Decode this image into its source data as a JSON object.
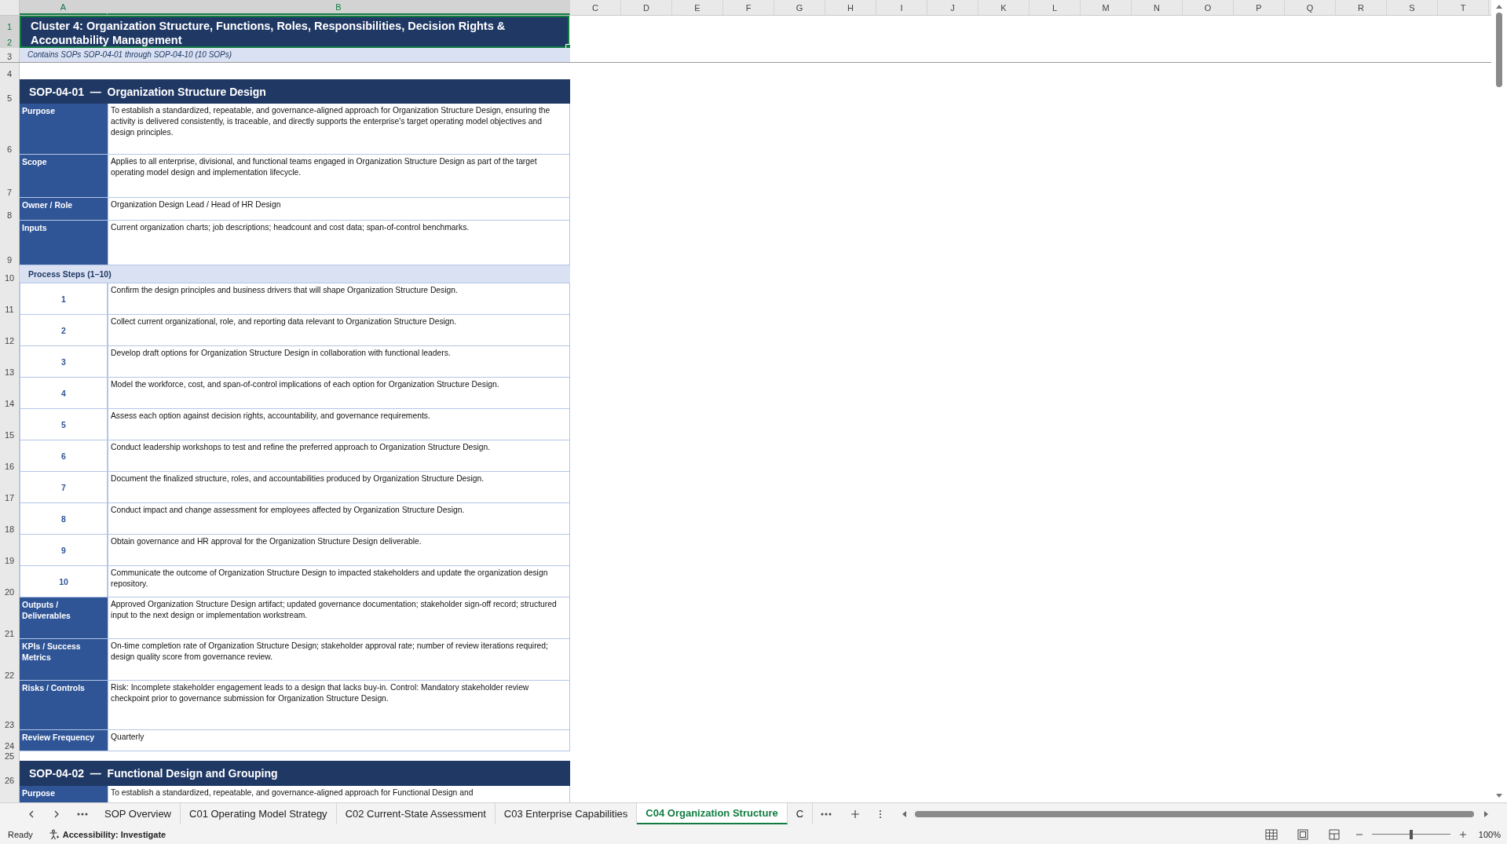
{
  "column_headers": [
    {
      "label": "A",
      "selected": true
    },
    {
      "label": "B",
      "selected": true
    },
    {
      "label": "C",
      "selected": false
    },
    {
      "label": "D",
      "selected": false
    },
    {
      "label": "E",
      "selected": false
    },
    {
      "label": "F",
      "selected": false
    },
    {
      "label": "G",
      "selected": false
    },
    {
      "label": "H",
      "selected": false
    },
    {
      "label": "I",
      "selected": false
    },
    {
      "label": "J",
      "selected": false
    },
    {
      "label": "K",
      "selected": false
    },
    {
      "label": "L",
      "selected": false
    },
    {
      "label": "M",
      "selected": false
    },
    {
      "label": "N",
      "selected": false
    },
    {
      "label": "O",
      "selected": false
    },
    {
      "label": "P",
      "selected": false
    },
    {
      "label": "Q",
      "selected": false
    },
    {
      "label": "R",
      "selected": false
    },
    {
      "label": "S",
      "selected": false
    },
    {
      "label": "T",
      "selected": false
    }
  ],
  "cell_selection": {
    "selected": true
  },
  "rows": [
    {
      "numbers": [
        "1",
        "2"
      ],
      "kind": "cluster_title",
      "text": "Cluster 4: Organization Structure, Functions, Roles, Responsibilities, Decision Rights & Accountability Management"
    },
    {
      "numbers": [
        "3"
      ],
      "kind": "subtitle",
      "text": "Contains SOPs SOP-04-01 through SOP-04-10 (10 SOPs)"
    },
    {
      "numbers": [
        "4"
      ],
      "kind": "blank"
    },
    {
      "numbers": [
        "5"
      ],
      "kind": "sop_header",
      "text": "SOP-04-01  —  Organization Structure Design"
    },
    {
      "numbers": [
        "6"
      ],
      "kind": "field",
      "label": "Purpose",
      "value": "To establish a standardized, repeatable, and governance-aligned approach for Organization Structure Design, ensuring the activity is delivered consistently, is traceable, and directly supports the enterprise's target operating model objectives and design principles."
    },
    {
      "numbers": [
        "7"
      ],
      "kind": "field",
      "label": "Scope",
      "value": "Applies to all enterprise, divisional, and functional teams engaged in Organization Structure Design as part of the target operating model design and implementation lifecycle."
    },
    {
      "numbers": [
        "8"
      ],
      "kind": "field",
      "label": "Owner / Role",
      "value": "Organization Design Lead / Head of HR Design"
    },
    {
      "numbers": [
        "9"
      ],
      "kind": "field",
      "label": "Inputs",
      "value": "Current organization charts; job descriptions; headcount and cost data; span-of-control benchmarks."
    },
    {
      "numbers": [
        "10"
      ],
      "kind": "section",
      "text": "Process Steps (1–10)"
    },
    {
      "numbers": [
        "11"
      ],
      "kind": "step",
      "label": "1",
      "value": "Confirm the design principles and business drivers that will shape Organization Structure Design."
    },
    {
      "numbers": [
        "12"
      ],
      "kind": "step",
      "label": "2",
      "value": "Collect current organizational, role, and reporting data relevant to Organization Structure Design."
    },
    {
      "numbers": [
        "13"
      ],
      "kind": "step",
      "label": "3",
      "value": "Develop draft options for Organization Structure Design in collaboration with functional leaders."
    },
    {
      "numbers": [
        "14"
      ],
      "kind": "step",
      "label": "4",
      "value": "Model the workforce, cost, and span-of-control implications of each option for Organization Structure Design."
    },
    {
      "numbers": [
        "15"
      ],
      "kind": "step",
      "label": "5",
      "value": "Assess each option against decision rights, accountability, and governance requirements."
    },
    {
      "numbers": [
        "16"
      ],
      "kind": "step",
      "label": "6",
      "value": "Conduct leadership workshops to test and refine the preferred approach to Organization Structure Design."
    },
    {
      "numbers": [
        "17"
      ],
      "kind": "step",
      "label": "7",
      "value": "Document the finalized structure, roles, and accountabilities produced by Organization Structure Design."
    },
    {
      "numbers": [
        "18"
      ],
      "kind": "step",
      "label": "8",
      "value": "Conduct impact and change assessment for employees affected by Organization Structure Design."
    },
    {
      "numbers": [
        "19"
      ],
      "kind": "step",
      "label": "9",
      "value": "Obtain governance and HR approval for the Organization Structure Design deliverable."
    },
    {
      "numbers": [
        "20"
      ],
      "kind": "step",
      "label": "10",
      "value": "Communicate the outcome of Organization Structure Design to impacted stakeholders and update the organization design repository."
    },
    {
      "numbers": [
        "21"
      ],
      "kind": "field",
      "label": "Outputs / Deliverables",
      "value": "Approved Organization Structure Design artifact; updated governance documentation; stakeholder sign-off record; structured input to the next design or implementation workstream."
    },
    {
      "numbers": [
        "22"
      ],
      "kind": "field",
      "label": "KPIs / Success Metrics",
      "value": "On-time completion rate of Organization Structure Design; stakeholder approval rate; number of review iterations required; design quality score from governance review."
    },
    {
      "numbers": [
        "23"
      ],
      "kind": "field",
      "label": "Risks / Controls",
      "value": "Risk: Incomplete stakeholder engagement leads to a design that lacks buy-in. Control: Mandatory stakeholder review checkpoint prior to governance submission for Organization Structure Design."
    },
    {
      "numbers": [
        "24"
      ],
      "kind": "field",
      "label": "Review Frequency",
      "value": "Quarterly"
    },
    {
      "numbers": [
        "25"
      ],
      "kind": "blank"
    },
    {
      "numbers": [
        "26"
      ],
      "kind": "sop_header",
      "text": "SOP-04-02  —  Functional Design and Grouping"
    },
    {
      "numbers": [],
      "kind": "field",
      "label": "Purpose",
      "value": "To establish a standardized, repeatable, and governance-aligned approach for Functional Design and"
    }
  ],
  "sheet_tabs": [
    {
      "label": "SOP Overview",
      "selected": false
    },
    {
      "label": "C01 Operating Model Strategy",
      "selected": false
    },
    {
      "label": "C02 Current-State Assessment",
      "selected": false
    },
    {
      "label": "C03 Enterprise Capabilities",
      "selected": false
    },
    {
      "label": "C04 Organization Structure",
      "selected": true
    },
    {
      "label": "C",
      "selected": false
    }
  ],
  "status_bar": {
    "mode": "Ready",
    "accessibility": "Accessibility: Investigate",
    "zoom": "100%",
    "zoom_slider": {
      "level": 0.5
    }
  }
}
